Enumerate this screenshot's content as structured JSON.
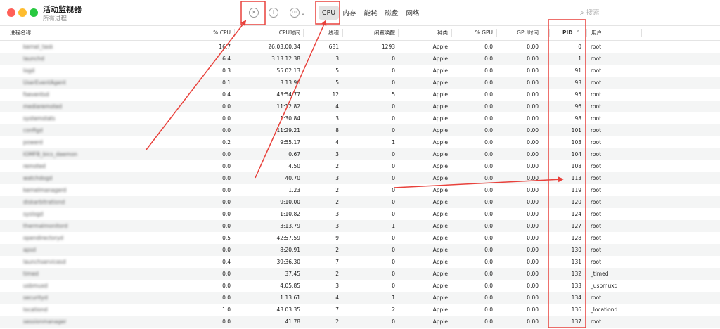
{
  "window": {
    "title": "活动监视器",
    "subtitle": "所有进程"
  },
  "toolbar": {
    "stop_icon": "stop-process-icon",
    "info_icon": "info-icon",
    "more_icon": "more-icon",
    "tabs": [
      {
        "label": "CPU",
        "active": true
      },
      {
        "label": "内存",
        "active": false
      },
      {
        "label": "能耗",
        "active": false
      },
      {
        "label": "磁盘",
        "active": false
      },
      {
        "label": "网络",
        "active": false
      }
    ],
    "search_placeholder": "搜索"
  },
  "table": {
    "columns": [
      "进程名称",
      "% CPU",
      "CPU时间",
      "线程",
      "闲置唤醒",
      "种类",
      "% GPU",
      "GPU时间",
      "PID",
      "用户"
    ],
    "sort_column": "PID",
    "sort_direction": "ascending",
    "sort_indicator": "^",
    "rows": [
      {
        "name": "kernel_task",
        "cpu": "16.7",
        "cpu_time": "26:03:00.34",
        "threads": "681",
        "idle_wake": "1293",
        "kind": "Apple",
        "gpu": "0.0",
        "gpu_time": "0.00",
        "pid": "0",
        "user": "root"
      },
      {
        "name": "launchd",
        "cpu": "6.4",
        "cpu_time": "3:13:12.38",
        "threads": "3",
        "idle_wake": "0",
        "kind": "Apple",
        "gpu": "0.0",
        "gpu_time": "0.00",
        "pid": "1",
        "user": "root"
      },
      {
        "name": "logd",
        "cpu": "0.3",
        "cpu_time": "55:02.13",
        "threads": "5",
        "idle_wake": "0",
        "kind": "Apple",
        "gpu": "0.0",
        "gpu_time": "0.00",
        "pid": "91",
        "user": "root"
      },
      {
        "name": "UserEventAgent",
        "cpu": "0.1",
        "cpu_time": "3:13.96",
        "threads": "5",
        "idle_wake": "0",
        "kind": "Apple",
        "gpu": "0.0",
        "gpu_time": "0.00",
        "pid": "93",
        "user": "root"
      },
      {
        "name": "fseventsd",
        "cpu": "0.4",
        "cpu_time": "43:54.77",
        "threads": "12",
        "idle_wake": "5",
        "kind": "Apple",
        "gpu": "0.0",
        "gpu_time": "0.00",
        "pid": "95",
        "user": "root"
      },
      {
        "name": "mediaremoted",
        "cpu": "0.0",
        "cpu_time": "11:12.82",
        "threads": "4",
        "idle_wake": "0",
        "kind": "Apple",
        "gpu": "0.0",
        "gpu_time": "0.00",
        "pid": "96",
        "user": "root"
      },
      {
        "name": "systemstats",
        "cpu": "0.0",
        "cpu_time": "1:30.84",
        "threads": "3",
        "idle_wake": "0",
        "kind": "Apple",
        "gpu": "0.0",
        "gpu_time": "0.00",
        "pid": "98",
        "user": "root"
      },
      {
        "name": "configd",
        "cpu": "0.0",
        "cpu_time": "11:29.21",
        "threads": "8",
        "idle_wake": "0",
        "kind": "Apple",
        "gpu": "0.0",
        "gpu_time": "0.00",
        "pid": "101",
        "user": "root"
      },
      {
        "name": "powerd",
        "cpu": "0.2",
        "cpu_time": "9:55.17",
        "threads": "4",
        "idle_wake": "1",
        "kind": "Apple",
        "gpu": "0.0",
        "gpu_time": "0.00",
        "pid": "103",
        "user": "root"
      },
      {
        "name": "IOMFB_bics_daemon",
        "cpu": "0.0",
        "cpu_time": "0.67",
        "threads": "3",
        "idle_wake": "0",
        "kind": "Apple",
        "gpu": "0.0",
        "gpu_time": "0.00",
        "pid": "104",
        "user": "root"
      },
      {
        "name": "remoted",
        "cpu": "0.0",
        "cpu_time": "4.50",
        "threads": "2",
        "idle_wake": "0",
        "kind": "Apple",
        "gpu": "0.0",
        "gpu_time": "0.00",
        "pid": "108",
        "user": "root"
      },
      {
        "name": "watchdogd",
        "cpu": "0.0",
        "cpu_time": "40.70",
        "threads": "3",
        "idle_wake": "0",
        "kind": "Apple",
        "gpu": "0.0",
        "gpu_time": "0.00",
        "pid": "113",
        "user": "root"
      },
      {
        "name": "kernelmanagerd",
        "cpu": "0.0",
        "cpu_time": "1.23",
        "threads": "2",
        "idle_wake": "0",
        "kind": "Apple",
        "gpu": "0.0",
        "gpu_time": "0.00",
        "pid": "119",
        "user": "root"
      },
      {
        "name": "diskarbitrationd",
        "cpu": "0.0",
        "cpu_time": "9:10.00",
        "threads": "2",
        "idle_wake": "0",
        "kind": "Apple",
        "gpu": "0.0",
        "gpu_time": "0.00",
        "pid": "120",
        "user": "root"
      },
      {
        "name": "syslogd",
        "cpu": "0.0",
        "cpu_time": "1:10.82",
        "threads": "3",
        "idle_wake": "0",
        "kind": "Apple",
        "gpu": "0.0",
        "gpu_time": "0.00",
        "pid": "124",
        "user": "root"
      },
      {
        "name": "thermalmonitord",
        "cpu": "0.0",
        "cpu_time": "3:13.79",
        "threads": "3",
        "idle_wake": "1",
        "kind": "Apple",
        "gpu": "0.0",
        "gpu_time": "0.00",
        "pid": "127",
        "user": "root"
      },
      {
        "name": "opendirectoryd",
        "cpu": "0.5",
        "cpu_time": "42:57.59",
        "threads": "9",
        "idle_wake": "0",
        "kind": "Apple",
        "gpu": "0.0",
        "gpu_time": "0.00",
        "pid": "128",
        "user": "root"
      },
      {
        "name": "apsd",
        "cpu": "0.0",
        "cpu_time": "8:20.91",
        "threads": "2",
        "idle_wake": "0",
        "kind": "Apple",
        "gpu": "0.0",
        "gpu_time": "0.00",
        "pid": "130",
        "user": "root"
      },
      {
        "name": "launchservicesd",
        "cpu": "0.4",
        "cpu_time": "39:36.30",
        "threads": "7",
        "idle_wake": "0",
        "kind": "Apple",
        "gpu": "0.0",
        "gpu_time": "0.00",
        "pid": "131",
        "user": "root"
      },
      {
        "name": "timed",
        "cpu": "0.0",
        "cpu_time": "37.45",
        "threads": "2",
        "idle_wake": "0",
        "kind": "Apple",
        "gpu": "0.0",
        "gpu_time": "0.00",
        "pid": "132",
        "user": "_timed"
      },
      {
        "name": "usbmuxd",
        "cpu": "0.0",
        "cpu_time": "4:05.85",
        "threads": "3",
        "idle_wake": "0",
        "kind": "Apple",
        "gpu": "0.0",
        "gpu_time": "0.00",
        "pid": "133",
        "user": "_usbmuxd"
      },
      {
        "name": "securityd",
        "cpu": "0.0",
        "cpu_time": "1:13.61",
        "threads": "4",
        "idle_wake": "1",
        "kind": "Apple",
        "gpu": "0.0",
        "gpu_time": "0.00",
        "pid": "134",
        "user": "root"
      },
      {
        "name": "locationd",
        "cpu": "1.0",
        "cpu_time": "43:03.35",
        "threads": "7",
        "idle_wake": "2",
        "kind": "Apple",
        "gpu": "0.0",
        "gpu_time": "0.00",
        "pid": "136",
        "user": "_locationd"
      },
      {
        "name": "sessionmanager",
        "cpu": "0.0",
        "cpu_time": "41.78",
        "threads": "2",
        "idle_wake": "0",
        "kind": "Apple",
        "gpu": "0.0",
        "gpu_time": "0.00",
        "pid": "137",
        "user": "root"
      }
    ]
  },
  "annotations": {
    "color": "#e8413b"
  }
}
